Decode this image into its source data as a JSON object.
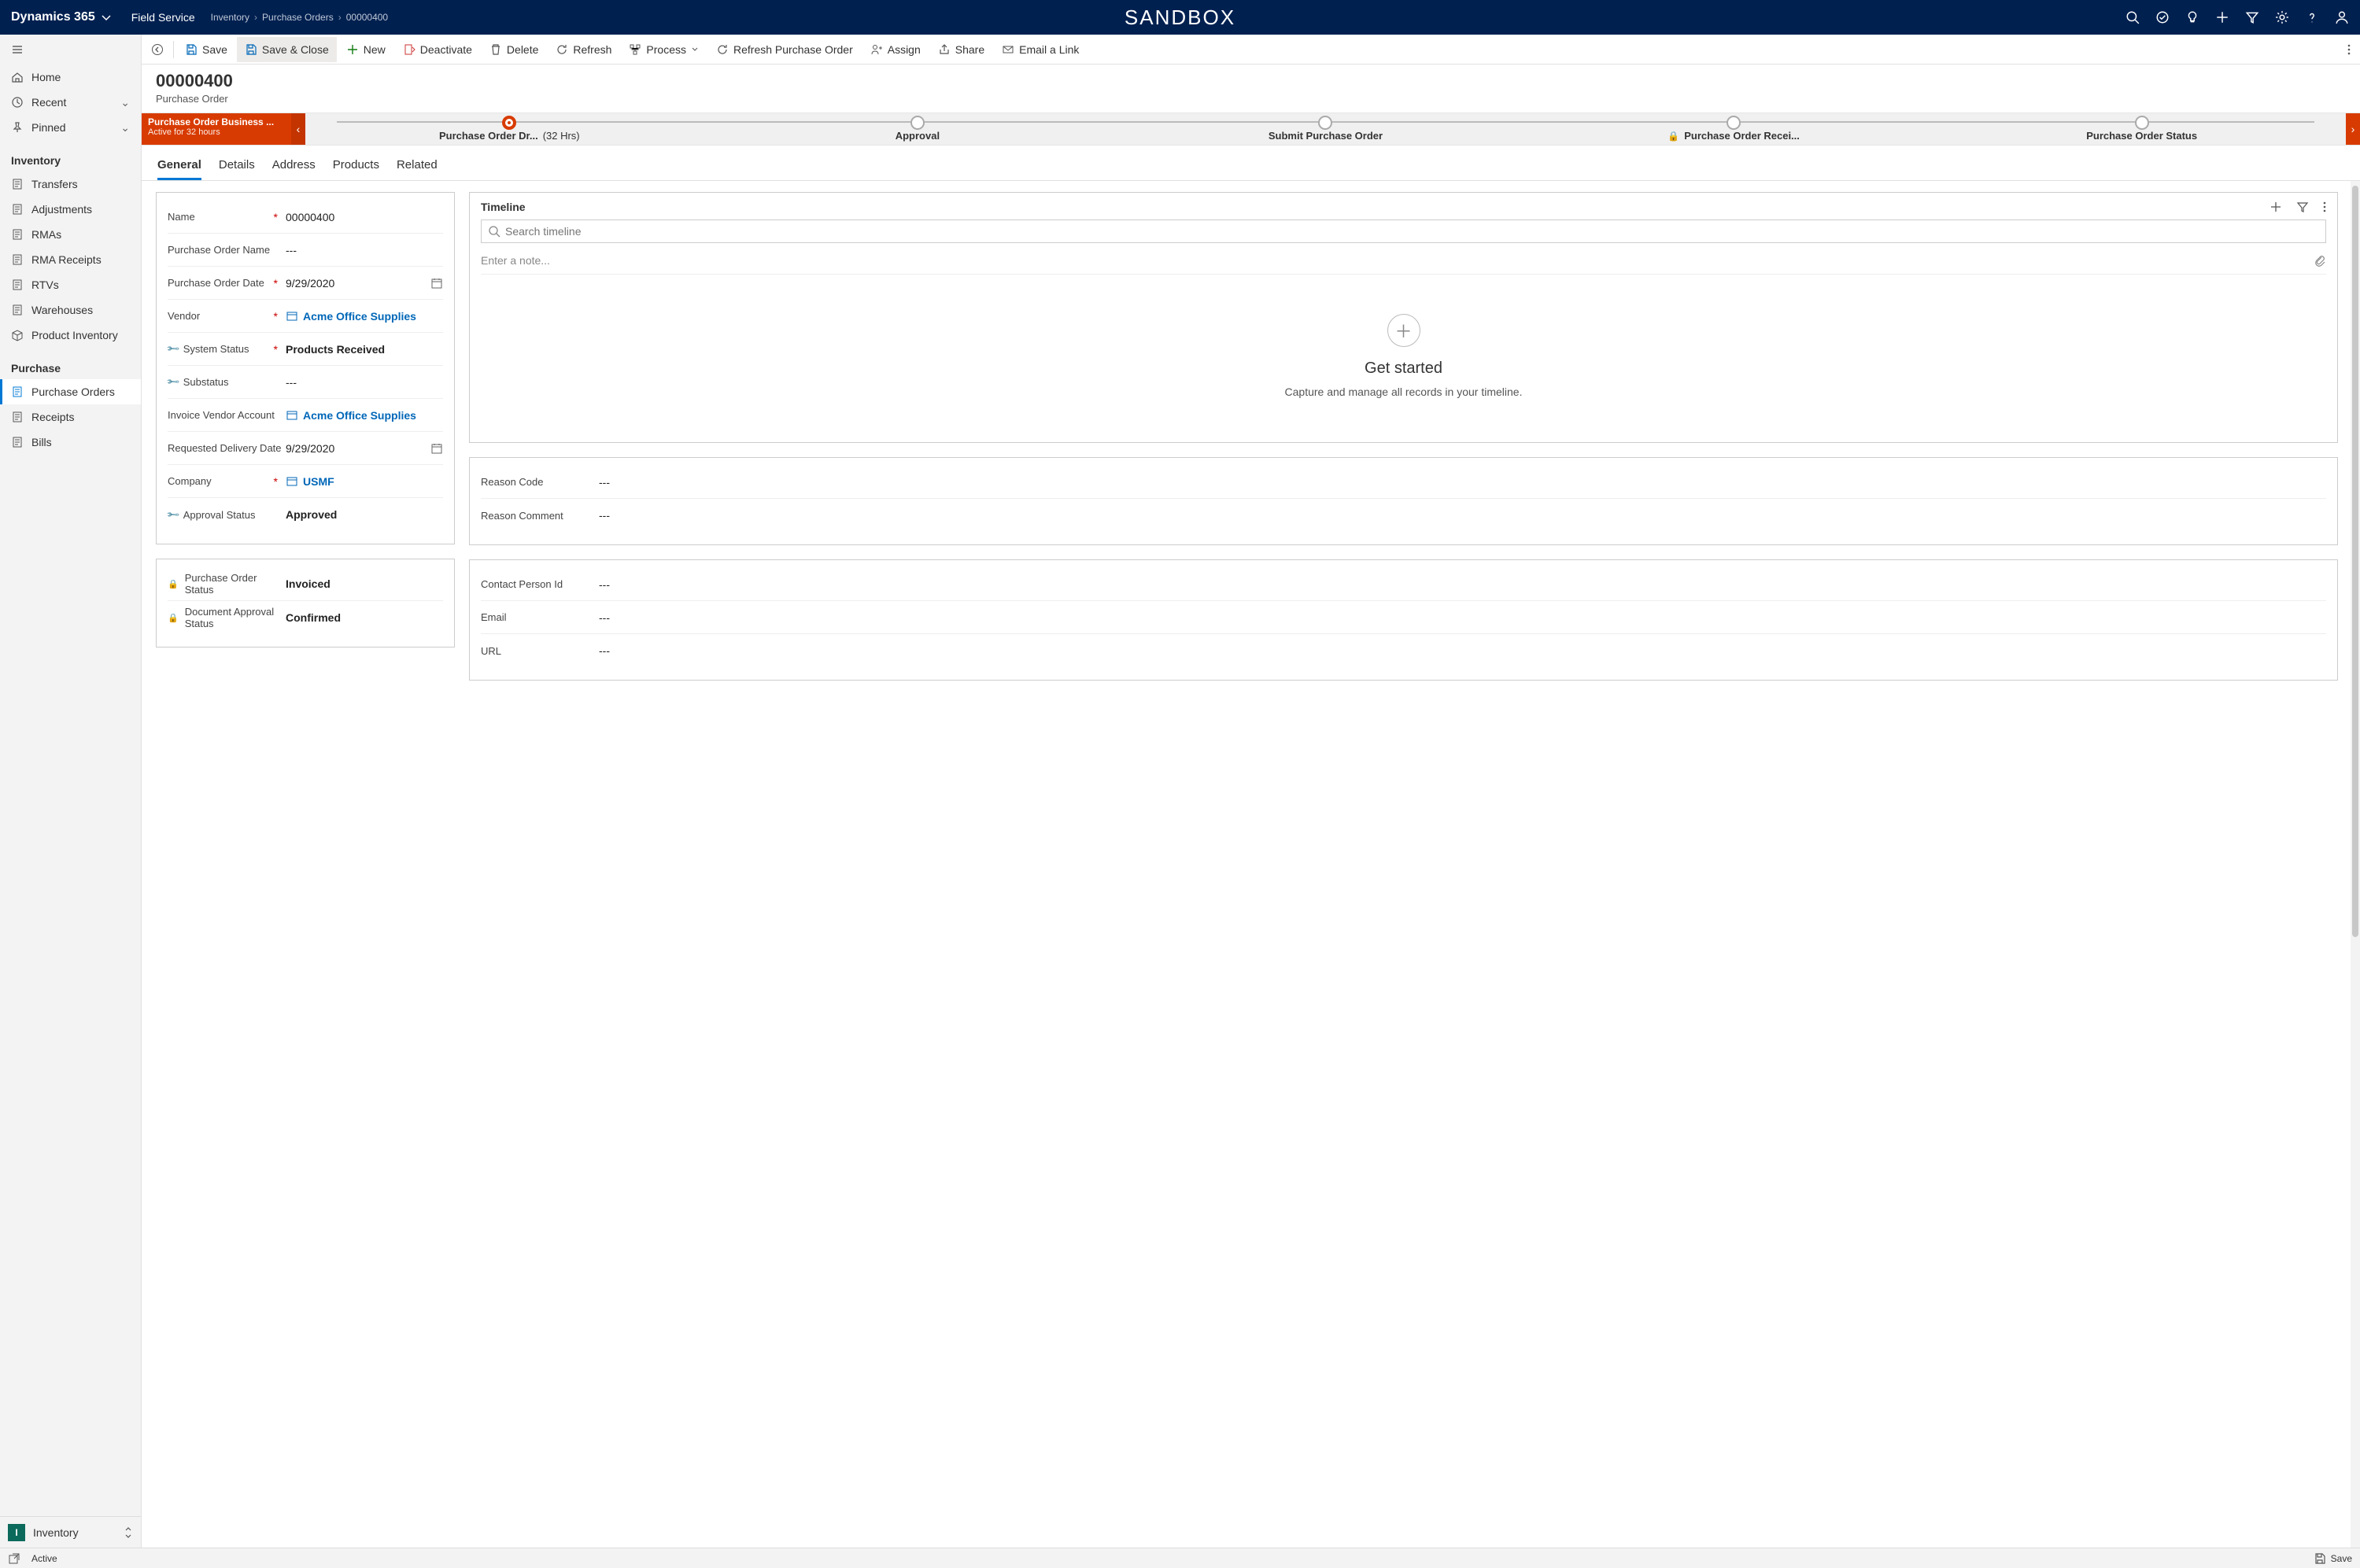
{
  "topnav": {
    "app": "Dynamics 365",
    "module": "Field Service",
    "breadcrumbs": [
      "Inventory",
      "Purchase Orders",
      "00000400"
    ],
    "env_label": "SANDBOX"
  },
  "leftnav": {
    "top": [
      {
        "icon": "home",
        "label": "Home"
      },
      {
        "icon": "clock",
        "label": "Recent",
        "chev": true
      },
      {
        "icon": "pin",
        "label": "Pinned",
        "chev": true
      }
    ],
    "sections": [
      {
        "title": "Inventory",
        "items": [
          {
            "icon": "doc",
            "label": "Transfers"
          },
          {
            "icon": "doc",
            "label": "Adjustments"
          },
          {
            "icon": "doc",
            "label": "RMAs"
          },
          {
            "icon": "doc",
            "label": "RMA Receipts"
          },
          {
            "icon": "doc",
            "label": "RTVs"
          },
          {
            "icon": "doc",
            "label": "Warehouses"
          },
          {
            "icon": "box",
            "label": "Product Inventory"
          }
        ]
      },
      {
        "title": "Purchase",
        "items": [
          {
            "icon": "doc",
            "label": "Purchase Orders",
            "selected": true
          },
          {
            "icon": "doc",
            "label": "Receipts"
          },
          {
            "icon": "doc",
            "label": "Bills"
          }
        ]
      }
    ],
    "switcher": {
      "badge": "I",
      "label": "Inventory"
    }
  },
  "cmdbar": [
    {
      "id": "goback",
      "icon": "goback",
      "label": ""
    },
    {
      "id": "save",
      "icon": "save",
      "label": "Save"
    },
    {
      "id": "saveclose",
      "icon": "save",
      "label": "Save & Close",
      "highlight": true
    },
    {
      "id": "new",
      "icon": "plus",
      "label": "New",
      "color": "#107c10"
    },
    {
      "id": "deactivate",
      "icon": "deact",
      "label": "Deactivate"
    },
    {
      "id": "delete",
      "icon": "trash",
      "label": "Delete"
    },
    {
      "id": "refresh",
      "icon": "refresh",
      "label": "Refresh"
    },
    {
      "id": "process",
      "icon": "flow",
      "label": "Process",
      "dropdown": true
    },
    {
      "id": "refreshpo",
      "icon": "refresh",
      "label": "Refresh Purchase Order"
    },
    {
      "id": "assign",
      "icon": "assign",
      "label": "Assign"
    },
    {
      "id": "share",
      "icon": "share",
      "label": "Share"
    },
    {
      "id": "emaillink",
      "icon": "mail",
      "label": "Email a Link"
    }
  ],
  "header": {
    "title": "00000400",
    "subtitle": "Purchase Order"
  },
  "bpf": {
    "name": "Purchase Order Business ...",
    "status": "Active for 32 hours",
    "stages": [
      {
        "label": "Purchase Order Dr...",
        "duration": "(32 Hrs)",
        "active": true
      },
      {
        "label": "Approval"
      },
      {
        "label": "Submit Purchase Order"
      },
      {
        "label": "Purchase Order Recei...",
        "locked": true
      },
      {
        "label": "Purchase Order Status"
      }
    ]
  },
  "tabs": [
    "General",
    "Details",
    "Address",
    "Products",
    "Related"
  ],
  "active_tab": "General",
  "form": {
    "main": [
      {
        "label": "Name",
        "required": true,
        "value": "00000400"
      },
      {
        "label": "Purchase Order Name",
        "value": "---"
      },
      {
        "label": "Purchase Order Date",
        "required": true,
        "value": "9/29/2020",
        "trail": "cal"
      },
      {
        "label": "Vendor",
        "required": true,
        "value": "Acme Office Supplies",
        "link": true,
        "lookupicon": true
      },
      {
        "label": "System Status",
        "labelicon": "key",
        "required": true,
        "value": "Products Received"
      },
      {
        "label": "Substatus",
        "labelicon": "key",
        "value": "---"
      },
      {
        "label": "Invoice Vendor Account",
        "value": "Acme Office Supplies",
        "link": true,
        "lookupicon": true
      },
      {
        "label": "Requested Delivery Date",
        "value": "9/29/2020",
        "trail": "cal"
      },
      {
        "label": "Company",
        "required": true,
        "value": "USMF",
        "link": true,
        "lookupicon": true
      },
      {
        "label": "Approval Status",
        "labelicon": "key",
        "value": "Approved"
      }
    ],
    "secondary": [
      {
        "label": "Purchase Order Status",
        "labelicon": "lock",
        "value": "Invoiced"
      },
      {
        "label": "Document Approval Status",
        "labelicon": "lock",
        "value": "Confirmed"
      }
    ],
    "reason": [
      {
        "label": "Reason Code",
        "value": "---"
      },
      {
        "label": "Reason Comment",
        "value": "---"
      }
    ],
    "contact": [
      {
        "label": "Contact Person Id",
        "value": "---"
      },
      {
        "label": "Email",
        "value": "---"
      },
      {
        "label": "URL",
        "value": "---"
      }
    ]
  },
  "timeline": {
    "title": "Timeline",
    "search_placeholder": "Search timeline",
    "note_placeholder": "Enter a note...",
    "get_started": "Get started",
    "get_started_text": "Capture and manage all records in your timeline."
  },
  "statusbar": {
    "status": "Active",
    "save": "Save"
  }
}
